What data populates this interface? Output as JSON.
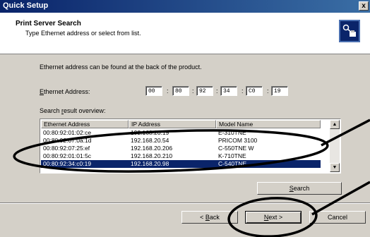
{
  "window": {
    "title": "Quick Setup",
    "close_glyph": "x"
  },
  "header": {
    "title": "Print Server Search",
    "subtitle": "Type Ethernet address or select from list.",
    "icon": "network-printer-icon"
  },
  "info_text": "Ethernet address can be found at the back of the product.",
  "ethernet": {
    "label_hotkey": "E",
    "label_rest": "thernet Address:",
    "octets": [
      "00",
      "80",
      "92",
      "34",
      "C0",
      "19"
    ],
    "separator": ":"
  },
  "results": {
    "label_prefix": "Search ",
    "label_hotkey": "r",
    "label_rest": "esult overview:",
    "columns": [
      "Ethernet Address",
      "IP Address",
      "Model Name"
    ],
    "rows": [
      {
        "eth": "00:80:92:01:02:ce",
        "ip": "192.168.20.19",
        "model": "E-310TNE"
      },
      {
        "eth": "00:80:92:07:0a:1d",
        "ip": "192.168.20.54",
        "model": "PRICOM 3100"
      },
      {
        "eth": "00:80:92:07:25:ef",
        "ip": "192.168.20.206",
        "model": "C-550TNE W"
      },
      {
        "eth": "00:80:92:01:01:5c",
        "ip": "192.168.20.210",
        "model": "K-710TNE"
      },
      {
        "eth": "00:80:92:34:c0:19",
        "ip": "192.168.20.98",
        "model": "C-540TNE"
      }
    ],
    "selected_index": 4,
    "scroll_up_glyph": "▲",
    "scroll_down_glyph": "▼"
  },
  "buttons": {
    "search_hotkey": "S",
    "search_rest": "earch",
    "back_prefix": "< ",
    "back_hotkey": "B",
    "back_rest": "ack",
    "next_hotkey": "N",
    "next_rest": "ext >",
    "cancel": "Cancel"
  },
  "colors": {
    "title_bar": "#0a246a",
    "selection": "#0a246a",
    "dialog_bg": "#d4d0c8"
  }
}
